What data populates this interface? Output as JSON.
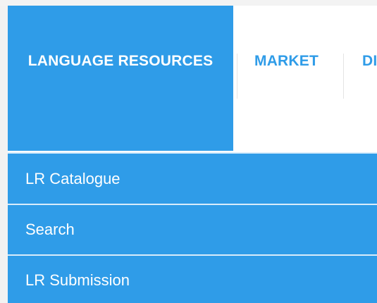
{
  "nav": {
    "items": [
      {
        "label": "LANGUAGE RESOURCES",
        "active": true
      },
      {
        "label": "MARKET",
        "active": false
      },
      {
        "label": "DI",
        "active": false
      }
    ]
  },
  "submenu": {
    "items": [
      {
        "label": "LR Catalogue"
      },
      {
        "label": "Search"
      },
      {
        "label": "LR Submission"
      }
    ]
  },
  "colors": {
    "accent": "#2f9ce8",
    "submenu_divider": "#d8ecfb",
    "nav_divider": "#e4e4e4",
    "background": "#ffffff",
    "gutter": "#f2f2f2"
  }
}
